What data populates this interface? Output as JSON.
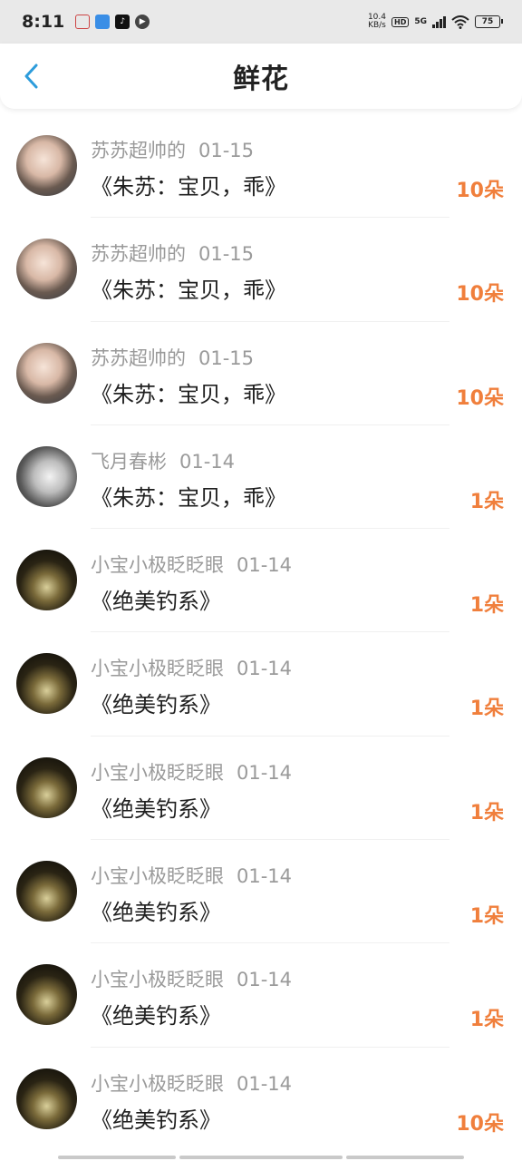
{
  "status_bar": {
    "time": "8:11",
    "net_speed_value": "10.4",
    "net_speed_unit": "KB/s",
    "hd": "HD",
    "network": "5G",
    "battery": "75"
  },
  "header": {
    "title": "鲜花",
    "back_icon": "chevron-left-icon",
    "accent_color": "#2d9cdb"
  },
  "records": [
    {
      "user": "苏苏超帅的",
      "date": "01-15",
      "work": "《朱苏：宝贝，乖》",
      "count": "10朵"
    },
    {
      "user": "苏苏超帅的",
      "date": "01-15",
      "work": "《朱苏：宝贝，乖》",
      "count": "10朵"
    },
    {
      "user": "苏苏超帅的",
      "date": "01-15",
      "work": "《朱苏：宝贝，乖》",
      "count": "10朵"
    },
    {
      "user": "飞月春彬",
      "date": "01-14",
      "work": "《朱苏：宝贝，乖》",
      "count": "1朵"
    },
    {
      "user": "小宝小极眨眨眼",
      "date": "01-14",
      "work": "《绝美钓系》",
      "count": "1朵"
    },
    {
      "user": "小宝小极眨眨眼",
      "date": "01-14",
      "work": "《绝美钓系》",
      "count": "1朵"
    },
    {
      "user": "小宝小极眨眨眼",
      "date": "01-14",
      "work": "《绝美钓系》",
      "count": "1朵"
    },
    {
      "user": "小宝小极眨眨眼",
      "date": "01-14",
      "work": "《绝美钓系》",
      "count": "1朵"
    },
    {
      "user": "小宝小极眨眨眼",
      "date": "01-14",
      "work": "《绝美钓系》",
      "count": "1朵"
    },
    {
      "user": "小宝小极眨眨眼",
      "date": "01-14",
      "work": "《绝美钓系》",
      "count": "10朵"
    }
  ],
  "colors": {
    "count": "#f07f3c",
    "meta": "#9a9a9a"
  }
}
